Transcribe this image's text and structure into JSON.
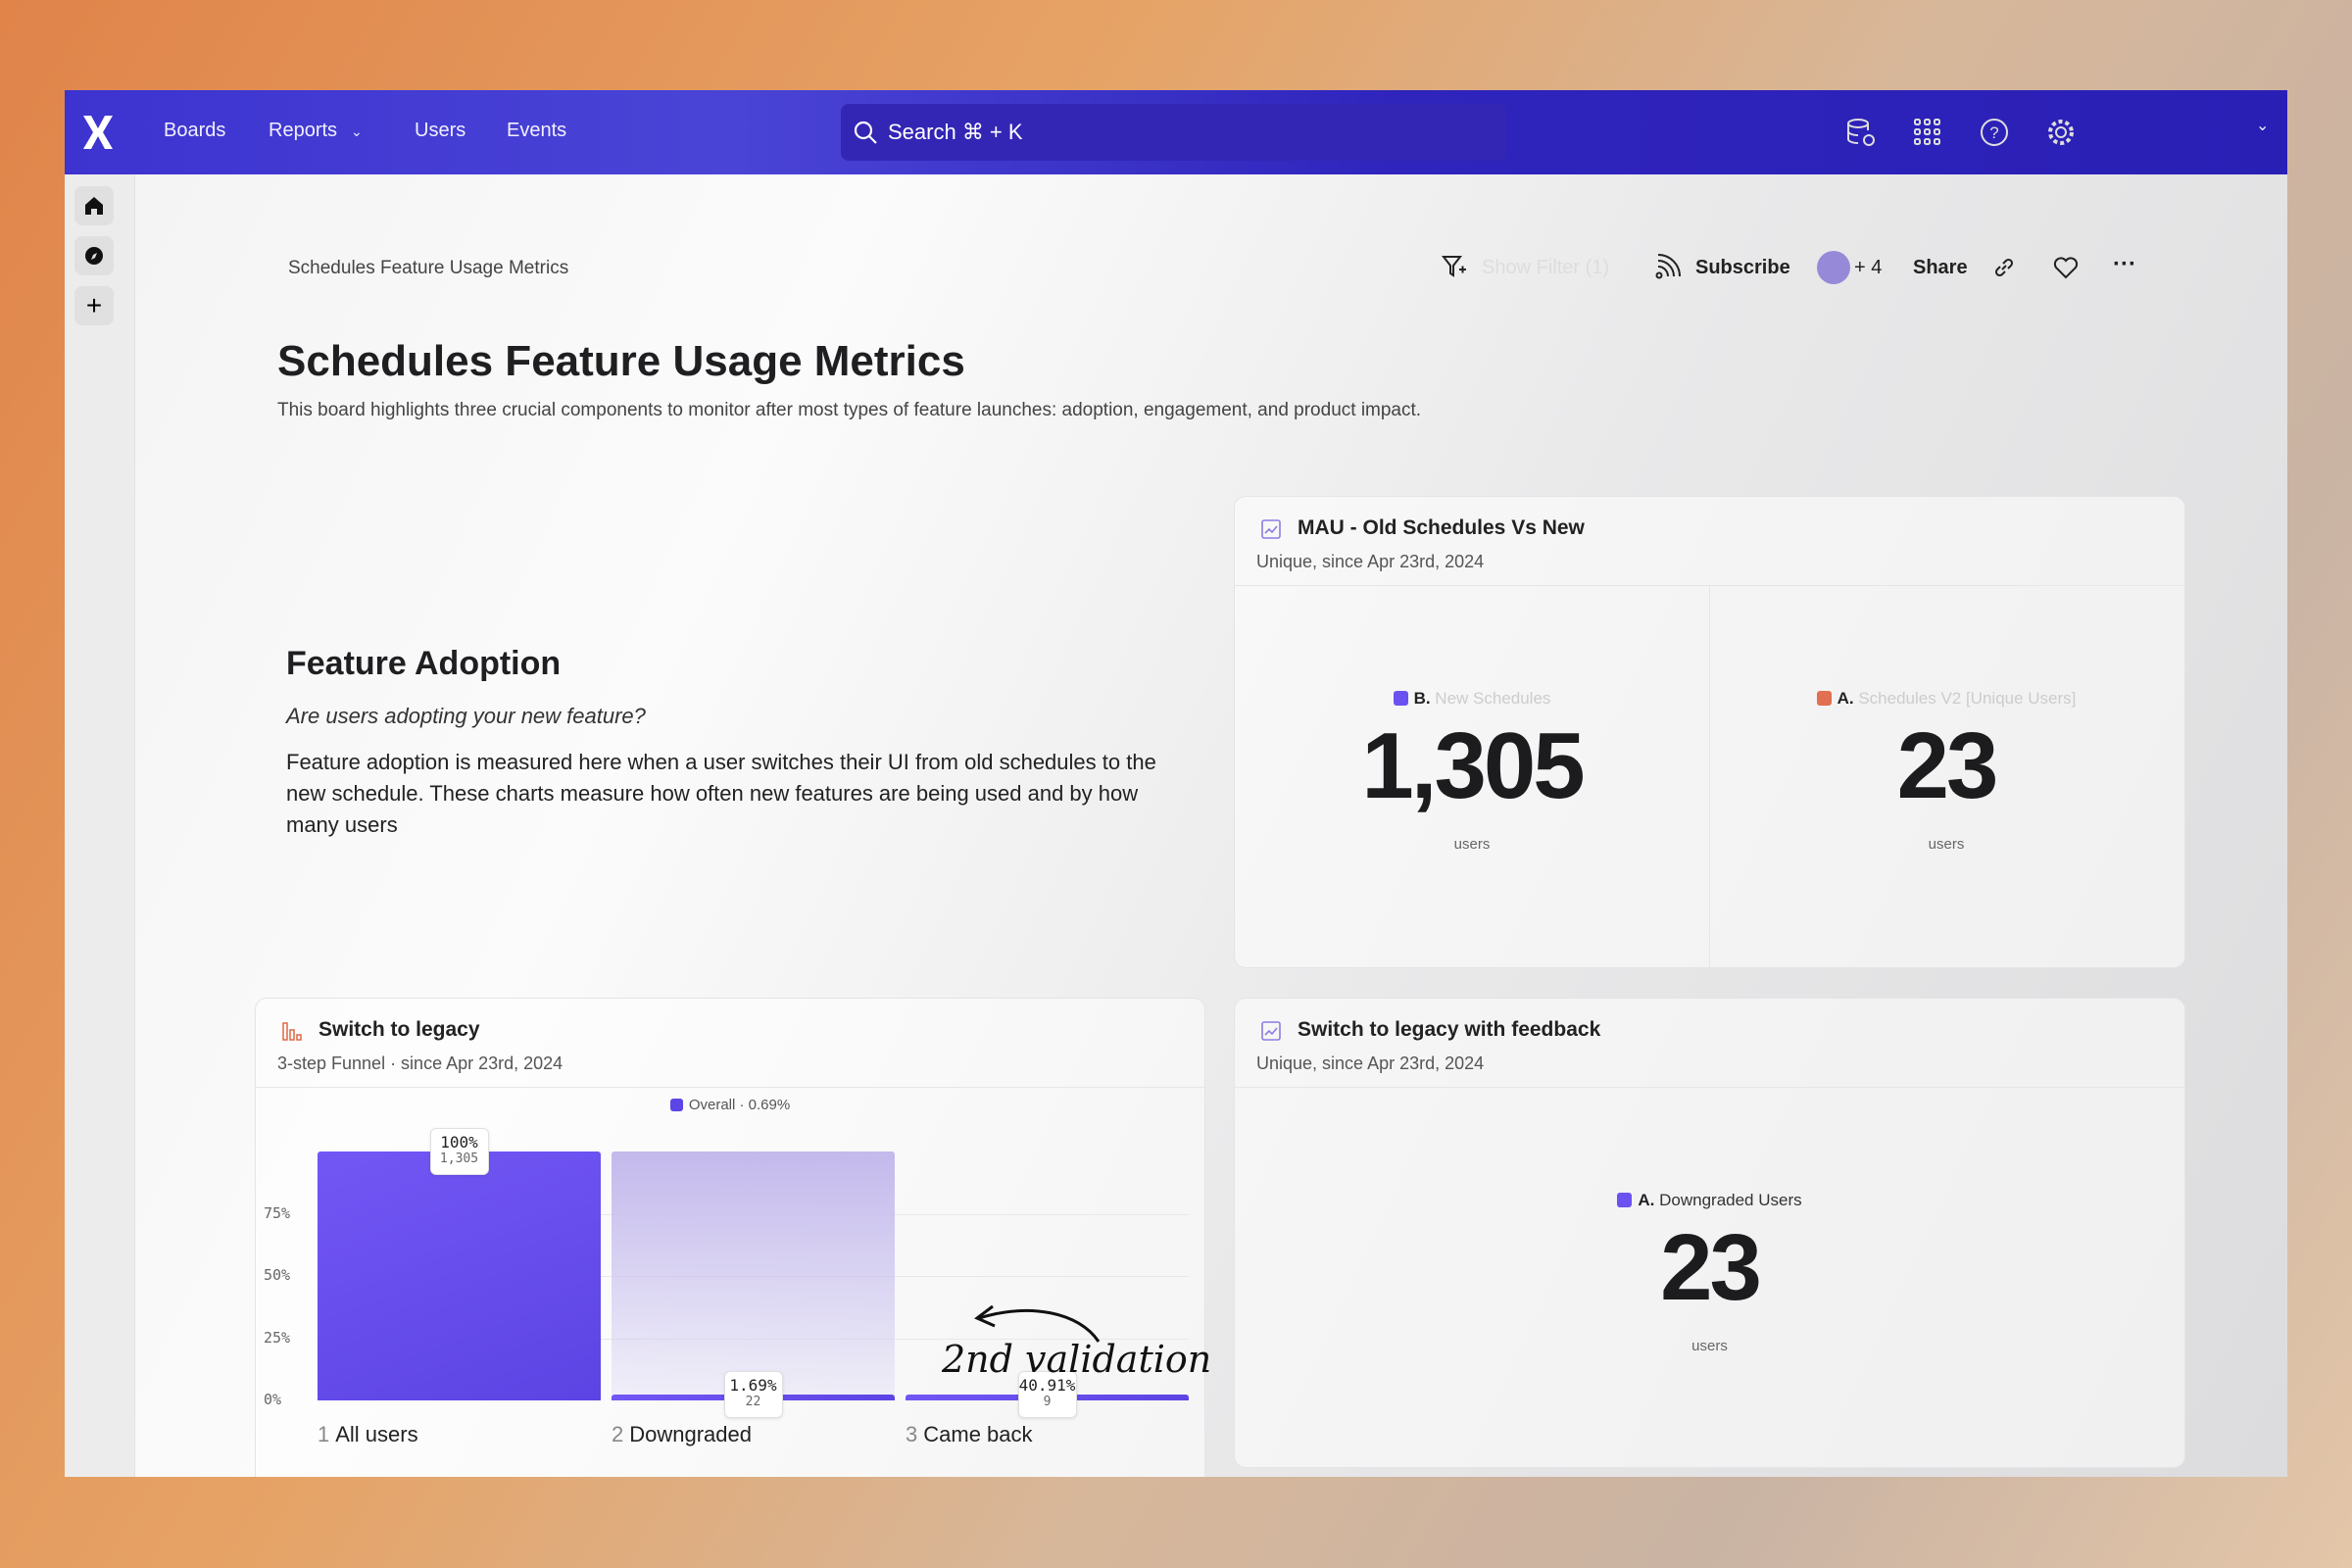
{
  "nav": {
    "items": [
      "Boards",
      "Reports",
      "Users",
      "Events"
    ],
    "search": "Search  ⌘ + K",
    "icons": [
      "data-settings-icon",
      "apps-grid-icon",
      "help-icon",
      "settings-icon",
      "chevron-down-icon"
    ]
  },
  "sidebar": {
    "icons": [
      "home-icon",
      "compass-icon",
      "plus-icon",
      "collapse-icon"
    ]
  },
  "header": {
    "breadcrumb": "Schedules Feature Usage Metrics",
    "filter": "Show Filter (1)",
    "subscribe": "Subscribe",
    "avatars_more": "+ 4",
    "share": "Share"
  },
  "page": {
    "title": "Schedules Feature Usage Metrics",
    "description": "This board highlights three crucial components to monitor after most types of feature launches: adoption, engagement, and product impact."
  },
  "adoption": {
    "heading": "Feature Adoption",
    "question": "Are users adopting your new feature?",
    "body": "Feature adoption is measured here when a user switches their UI from old schedules to the new schedule. These charts measure how often new features are being used and by how many users"
  },
  "mau": {
    "title": "MAU - Old Schedules Vs New",
    "subtitle": "Unique, since Apr 23rd, 2024",
    "metrics": [
      {
        "letter": "B.",
        "name": "New Schedules",
        "value": "1,305",
        "unit": "users",
        "color": "#6b52f0"
      },
      {
        "letter": "A.",
        "name": "Schedules V2 [Unique Users]",
        "value": "23",
        "unit": "users",
        "color": "#e0704f"
      }
    ]
  },
  "feedback": {
    "title": "Switch to legacy with feedback",
    "subtitle": "Unique, since Apr 23rd, 2024",
    "metric": {
      "letter": "A.",
      "name": "Downgraded Users",
      "value": "23",
      "unit": "users",
      "color": "#6b52f0"
    }
  },
  "funnel": {
    "title": "Switch to legacy",
    "subtitle": "3-step Funnel · since Apr 23rd, 2024",
    "annotation": "2nd validation"
  },
  "chart_data": {
    "type": "bar",
    "title": "Switch to legacy",
    "legend": "Overall · 0.69%",
    "legend_color": "#5b45e6",
    "categories": [
      "All users",
      "Downgraded",
      "Came back"
    ],
    "step_numbers": [
      "1",
      "2",
      "3"
    ],
    "values": [
      100,
      1.69,
      0.69
    ],
    "conversion_labels": [
      "100%",
      "1.69%",
      "40.91%"
    ],
    "counts": [
      "1,305",
      "22",
      "9"
    ],
    "yticks": [
      "0%",
      "25%",
      "50%",
      "75%"
    ],
    "ylim": [
      0,
      100
    ],
    "grid": true
  }
}
